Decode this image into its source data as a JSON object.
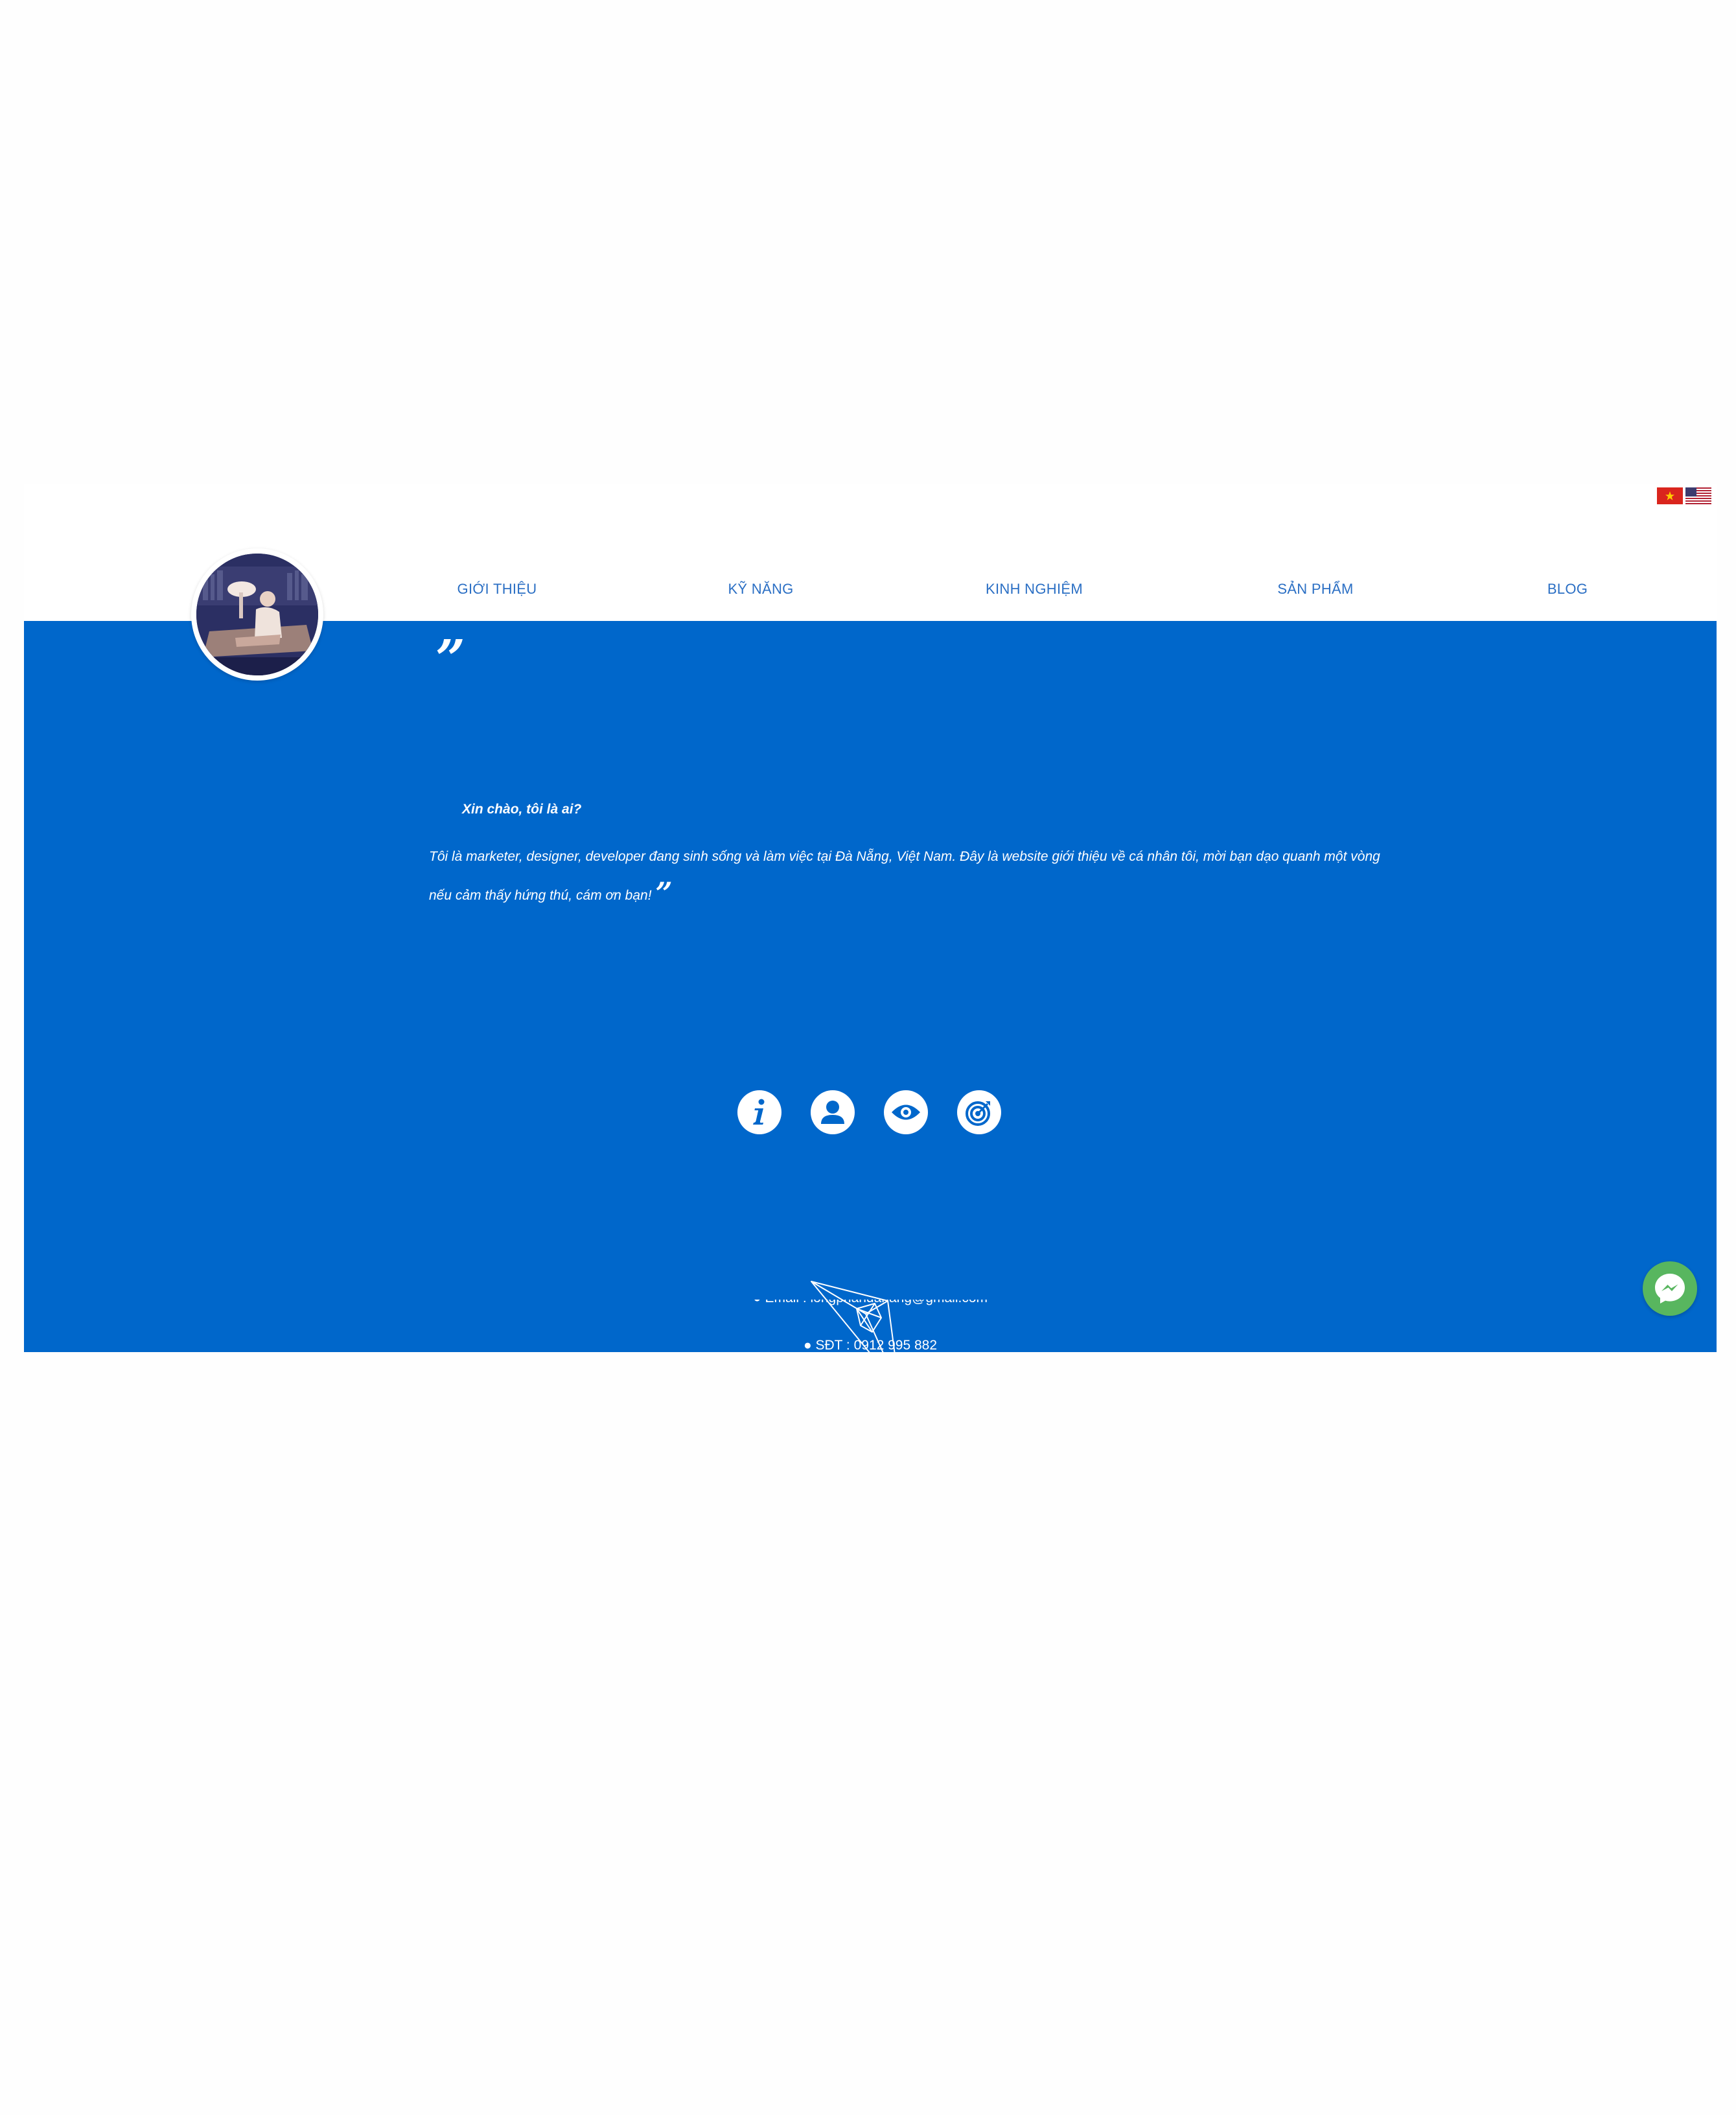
{
  "flags": [
    {
      "name": "vietnamese-flag"
    },
    {
      "name": "english-flag"
    }
  ],
  "nav": {
    "items": [
      {
        "label": "GIỚI THIỆU"
      },
      {
        "label": "KỸ NĂNG"
      },
      {
        "label": "KINH NGHIỆM"
      },
      {
        "label": "SẢN PHẨM"
      },
      {
        "label": "BLOG"
      }
    ]
  },
  "intro": {
    "open_quote": "”",
    "title": "Xin chào, tôi là ai?",
    "body": "Tôi là marketer, designer, developer đang sinh sống và làm việc tại Đà Nẵng, Việt Nam. Đây là website giới thiệu về cá nhân tôi, mời bạn dạo quanh một vòng nếu cảm thấy hứng thú, cám ơn bạn!",
    "close_quote": "”"
  },
  "icons": [
    "info-icon",
    "user-icon",
    "eye-icon",
    "target-icon"
  ],
  "contact": {
    "email": "● Email : longphandanang@gmail.com",
    "phone": "● SĐT : 0912 995 882"
  },
  "colors": {
    "hero_bg": "#0067cb",
    "nav_text": "#2b6fc4",
    "messenger_bg": "#58b65f"
  }
}
